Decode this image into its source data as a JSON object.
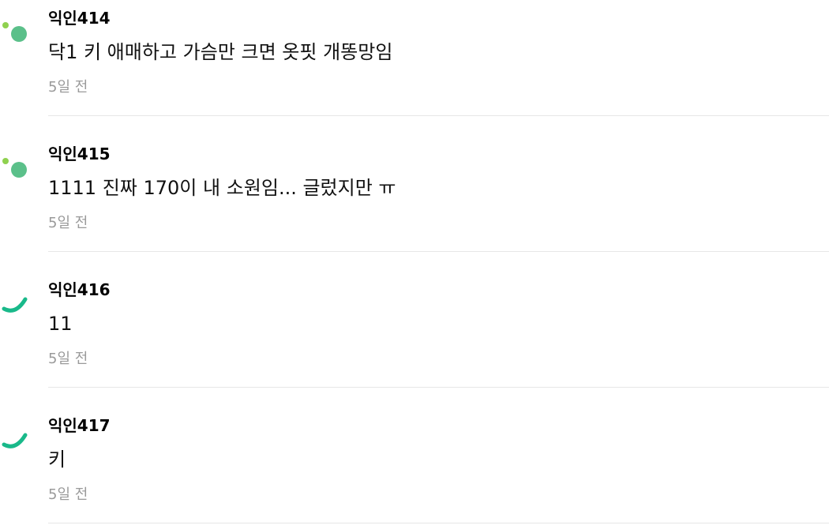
{
  "comments": [
    {
      "author": "익인414",
      "text": "닥1 키 애매하고 가슴만 크면 옷핏 개똥망임",
      "time": "5일 전",
      "avatar": "dot-avatar-icon"
    },
    {
      "author": "익인415",
      "text": "1111 진짜 170이 내 소원임... 글렀지만 ㅠ",
      "time": "5일 전",
      "avatar": "dot-avatar-icon"
    },
    {
      "author": "익인416",
      "text": "11",
      "time": "5일 전",
      "avatar": "arc-avatar-icon"
    },
    {
      "author": "익인417",
      "text": "키",
      "time": "5일 전",
      "avatar": "arc-avatar-icon"
    }
  ],
  "colors": {
    "avatar_green": "#5bc08a",
    "avatar_lime": "#8fd14f",
    "arc_green": "#19b98a",
    "time_gray": "#9a9a9a",
    "divider": "#e7e7e7"
  }
}
